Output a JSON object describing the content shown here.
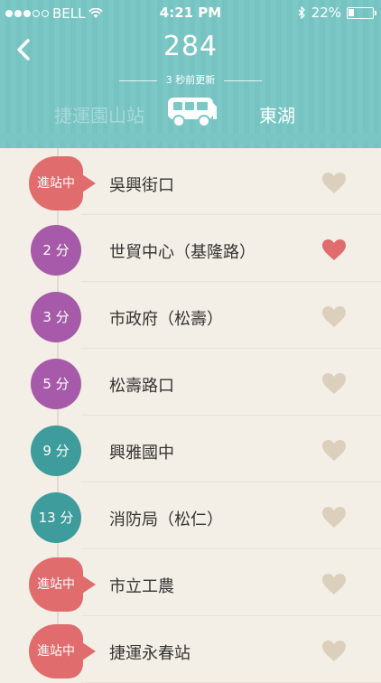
{
  "status_bar": {
    "carrier": "BELL",
    "time": "4:21 PM",
    "battery": "22%"
  },
  "header": {
    "route": "284",
    "updated": "3 秒前更新",
    "from_stop": "捷運園山站",
    "to_stop": "東湖"
  },
  "colors": {
    "arriving": "#e06c6e",
    "purple": "#a65aa9",
    "teal": "#3f9c9c",
    "heart_on": "#e06c6e",
    "heart_off": "#dcd0bd"
  },
  "stops": [
    {
      "eta": "進站中",
      "name": "吳興街口",
      "status": "arriving",
      "favorite": false
    },
    {
      "eta": "2 分",
      "name": "世貿中心（基隆路）",
      "status": "purple",
      "favorite": true
    },
    {
      "eta": "3 分",
      "name": "市政府（松壽）",
      "status": "purple",
      "favorite": false
    },
    {
      "eta": "5 分",
      "name": "松壽路口",
      "status": "purple",
      "favorite": false
    },
    {
      "eta": "9 分",
      "name": "興雅國中",
      "status": "teal",
      "favorite": false
    },
    {
      "eta": "13 分",
      "name": "消防局（松仁）",
      "status": "teal",
      "favorite": false
    },
    {
      "eta": "進站中",
      "name": "市立工農",
      "status": "arriving",
      "favorite": false
    },
    {
      "eta": "進站中",
      "name": "捷運永春站",
      "status": "arriving",
      "favorite": false
    }
  ]
}
